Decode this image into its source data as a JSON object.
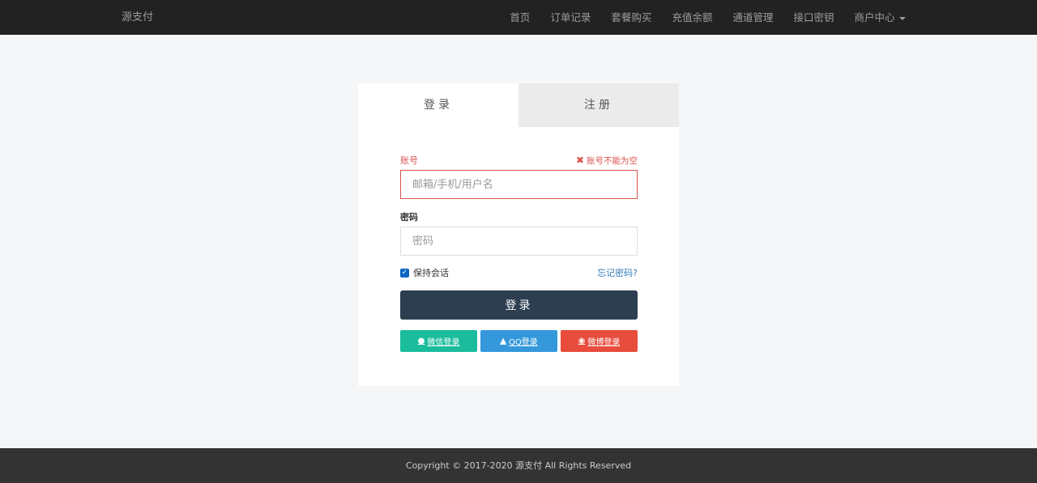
{
  "navbar": {
    "brand": "源支付",
    "items": [
      {
        "label": "首页"
      },
      {
        "label": "订单记录"
      },
      {
        "label": "套餐购买"
      },
      {
        "label": "充值余额"
      },
      {
        "label": "通道管理"
      },
      {
        "label": "接口密钥"
      },
      {
        "label": "商户中心"
      }
    ],
    "bg_color": "#222222"
  },
  "tabs": {
    "login": "登录",
    "register": "注册"
  },
  "form": {
    "account": {
      "label": "账号",
      "error": "账号不能为空",
      "placeholder": "邮箱/手机/用户名",
      "value": ""
    },
    "password": {
      "label": "密码",
      "placeholder": "密码",
      "value": ""
    },
    "remember": {
      "label": "保持会话",
      "checked": true
    },
    "forgot": "忘记密码?",
    "submit": "登录",
    "social": {
      "wechat": "微信登录",
      "qq": "QQ登录",
      "weibo": "微博登录"
    }
  },
  "footer": {
    "text": "Copyright © 2017-2020 源支付 All Rights Reserved"
  },
  "colors": {
    "error": "#d9534f",
    "primary_button": "#2c3e50",
    "wechat": "#1abc9c",
    "qq": "#3498db",
    "weibo": "#e74c3c",
    "link": "#337ab7"
  },
  "icons": {
    "error": "times-icon",
    "wechat": "wechat-icon",
    "qq": "qq-icon",
    "weibo": "weibo-icon",
    "dropdown": "caret-down-icon"
  }
}
